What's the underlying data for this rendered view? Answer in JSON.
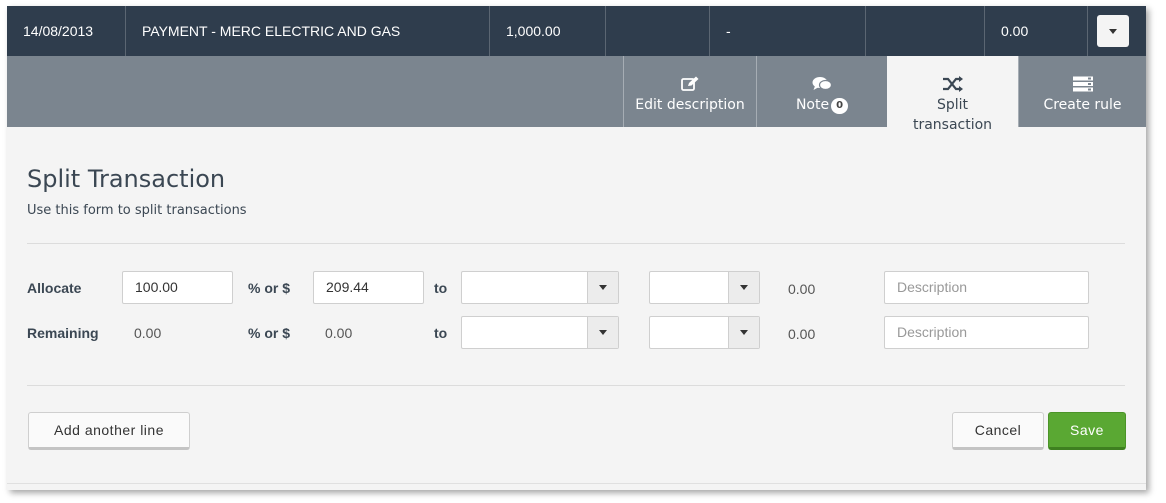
{
  "transaction": {
    "date": "14/08/2013",
    "description": "PAYMENT - MERC ELECTRIC AND GAS",
    "amount": "1,000.00",
    "col4": "",
    "col5": "-",
    "col6": "",
    "col7": "0.00"
  },
  "tabs": [
    {
      "label": "Edit description",
      "icon": "edit-icon"
    },
    {
      "label": "Note",
      "icon": "comments-icon",
      "count": "0"
    },
    {
      "label_line1": "Split",
      "label_line2": "transaction",
      "icon": "shuffle-icon",
      "active": true
    },
    {
      "label": "Create rule",
      "icon": "rule-list-icon"
    }
  ],
  "form": {
    "title": "Split Transaction",
    "subtitle": "Use this form to split transactions",
    "rows": [
      {
        "label": "Allocate",
        "percent_value": "100.00",
        "pct_label": "% or $",
        "dollar_value": "209.44",
        "to_label": "to",
        "account_value": "",
        "tax_value": "",
        "amount": "0.00",
        "description_placeholder": "Description"
      },
      {
        "label": "Remaining",
        "percent_value": "0.00",
        "pct_label": "% or $",
        "dollar_value": "0.00",
        "to_label": "to",
        "account_value": "",
        "tax_value": "",
        "amount": "0.00",
        "description_placeholder": "Description"
      }
    ],
    "add_line_label": "Add another line",
    "cancel_label": "Cancel",
    "save_label": "Save"
  },
  "colors": {
    "header_bg": "#2f3d4d",
    "tab_bar_bg": "#7b858f",
    "panel_bg": "#f4f4f4",
    "save_green": "#5aa833"
  }
}
